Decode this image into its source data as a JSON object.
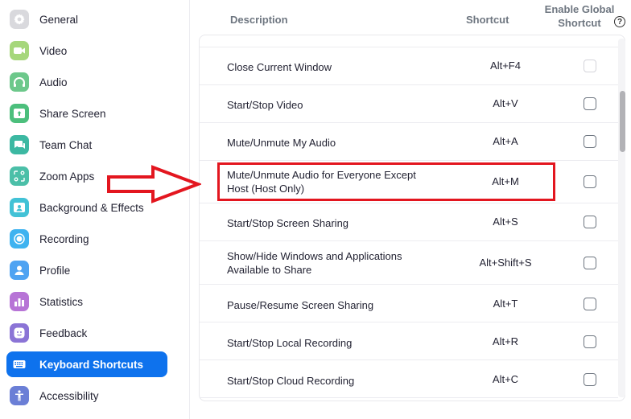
{
  "sidebar": {
    "items": [
      {
        "label": "General",
        "icon": "gear-icon",
        "color": "#d6d6da",
        "active": false
      },
      {
        "label": "Video",
        "icon": "video-camera-icon",
        "color": "#a4d67a",
        "active": false
      },
      {
        "label": "Audio",
        "icon": "headphones-icon",
        "color": "#6cc78a",
        "active": false
      },
      {
        "label": "Share Screen",
        "icon": "share-screen-icon",
        "color": "#4cbf7c",
        "active": false
      },
      {
        "label": "Team Chat",
        "icon": "chat-bubbles-icon",
        "color": "#3cb8a2",
        "active": false
      },
      {
        "label": "Zoom Apps",
        "icon": "apps-icon",
        "color": "#4bbfa8",
        "active": false
      },
      {
        "label": "Background & Effects",
        "icon": "background-person-icon",
        "color": "#42c2d6",
        "active": false
      },
      {
        "label": "Recording",
        "icon": "record-icon",
        "color": "#3fb3f0",
        "active": false
      },
      {
        "label": "Profile",
        "icon": "profile-person-icon",
        "color": "#4fa3f2",
        "active": false
      },
      {
        "label": "Statistics",
        "icon": "bar-chart-icon",
        "color": "#b774d6",
        "active": false
      },
      {
        "label": "Feedback",
        "icon": "smiley-icon",
        "color": "#8b74d6",
        "active": false
      },
      {
        "label": "Keyboard Shortcuts",
        "icon": "keyboard-icon",
        "color": "#0e72ed",
        "active": true
      },
      {
        "label": "Accessibility",
        "icon": "accessibility-icon",
        "color": "#6b7fd6",
        "active": false
      }
    ]
  },
  "table": {
    "headers": {
      "description": "Description",
      "shortcut": "Shortcut",
      "global_line1": "Enable Global",
      "global_line2": "Shortcut",
      "help_icon": "?"
    },
    "rows": [
      {
        "description": "Close Current Window",
        "shortcut": "Alt+F4",
        "global_enabled": false,
        "disabled": true
      },
      {
        "description": "Start/Stop Video",
        "shortcut": "Alt+V",
        "global_enabled": false,
        "disabled": false
      },
      {
        "description": "Mute/Unmute My Audio",
        "shortcut": "Alt+A",
        "global_enabled": false,
        "disabled": false
      },
      {
        "description": "Mute/Unmute Audio for Everyone Except",
        "description2": "Host (Host Only)",
        "shortcut": "Alt+M",
        "global_enabled": false,
        "disabled": false,
        "highlighted": true
      },
      {
        "description": "Start/Stop Screen Sharing",
        "shortcut": "Alt+S",
        "global_enabled": false,
        "disabled": false
      },
      {
        "description": "Show/Hide Windows and Applications",
        "description2": "Available to Share",
        "shortcut": "Alt+Shift+S",
        "global_enabled": false,
        "disabled": false
      },
      {
        "description": "Pause/Resume Screen Sharing",
        "shortcut": "Alt+T",
        "global_enabled": false,
        "disabled": false
      },
      {
        "description": "Start/Stop Local Recording",
        "shortcut": "Alt+R",
        "global_enabled": false,
        "disabled": false
      },
      {
        "description": "Start/Stop Cloud Recording",
        "shortcut": "Alt+C",
        "global_enabled": false,
        "disabled": false
      }
    ]
  },
  "annotations": {
    "arrow_color": "#e3161f",
    "box_color": "#e3161f"
  }
}
